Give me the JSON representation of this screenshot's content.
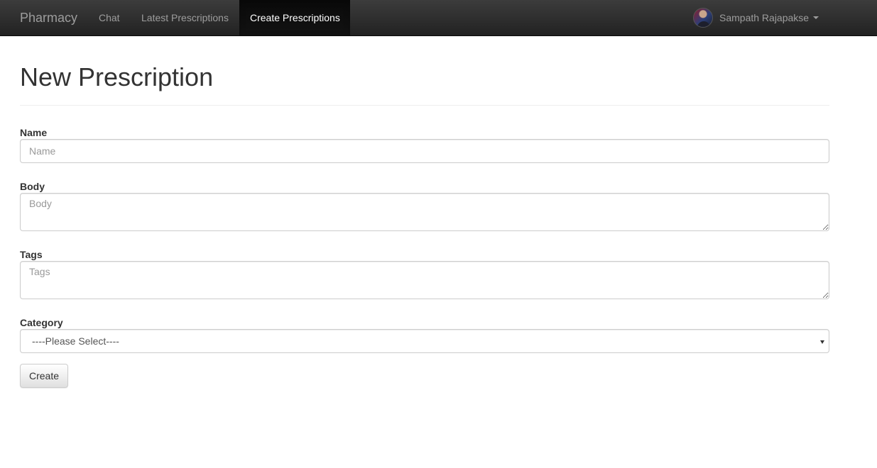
{
  "navbar": {
    "brand": "Pharmacy",
    "links": [
      {
        "label": "Chat",
        "active": false
      },
      {
        "label": "Latest Prescriptions",
        "active": false
      },
      {
        "label": "Create Prescriptions",
        "active": true
      }
    ],
    "user": {
      "name": "Sampath Rajapakse"
    }
  },
  "form": {
    "title": "New Prescription",
    "fields": {
      "name": {
        "label": "Name",
        "placeholder": "Name",
        "value": ""
      },
      "body": {
        "label": "Body",
        "placeholder": "Body",
        "value": ""
      },
      "tags": {
        "label": "Tags",
        "placeholder": "Tags",
        "value": ""
      },
      "category": {
        "label": "Category",
        "selected": "----Please Select----"
      }
    },
    "submit_label": "Create"
  }
}
